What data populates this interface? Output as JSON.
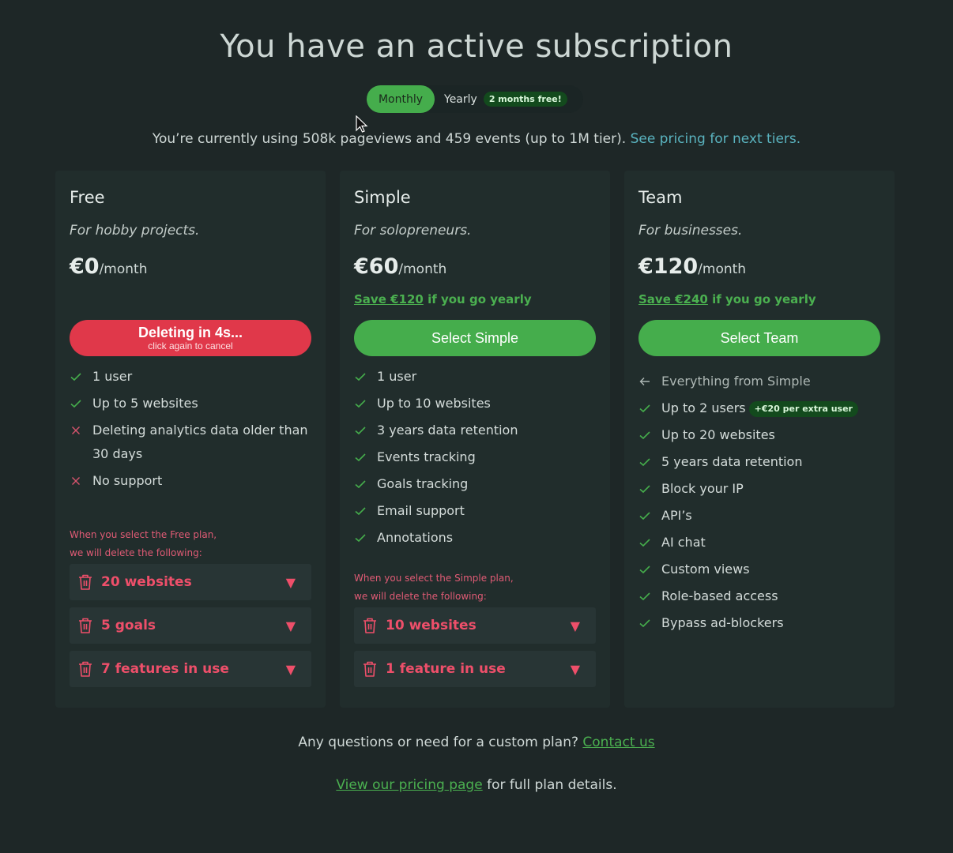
{
  "page": {
    "title": "You have an active subscription"
  },
  "billing_toggle": {
    "monthly_label": "Monthly",
    "yearly_label": "Yearly",
    "yearly_badge": "2 months free!",
    "selected": "Monthly"
  },
  "usage": {
    "text": "You’re currently using 508k pageviews and 459 events (up to 1M tier).",
    "link": "See pricing for next tiers."
  },
  "plans": {
    "free": {
      "name": "Free",
      "tagline": "For hobby projects.",
      "price": "€0",
      "period": "/month",
      "button_line1": "Deleting in 4s...",
      "button_line2": "click again to cancel",
      "features": [
        {
          "text": "1 user",
          "status": "included"
        },
        {
          "text": "Up to 5 websites",
          "status": "included"
        },
        {
          "text": "Deleting analytics data older than 30 days",
          "status": "excluded"
        },
        {
          "text": "No support",
          "status": "excluded"
        }
      ],
      "warning_line1": "When you select the Free plan,",
      "warning_line2": "we will delete the following:",
      "deletions": [
        "20 websites",
        "5 goals",
        "7 features in use"
      ]
    },
    "simple": {
      "name": "Simple",
      "tagline": "For solopreneurs.",
      "price": "€60",
      "period": "/month",
      "save_amount": "Save €120",
      "save_suffix": " if you go yearly",
      "button_label": "Select Simple",
      "features": [
        {
          "text": "1 user",
          "status": "included"
        },
        {
          "text": "Up to 10 websites",
          "status": "included"
        },
        {
          "text": "3 years data retention",
          "status": "included"
        },
        {
          "text": "Events tracking",
          "status": "included"
        },
        {
          "text": "Goals tracking",
          "status": "included"
        },
        {
          "text": "Email support",
          "status": "included"
        },
        {
          "text": "Annotations",
          "status": "included"
        }
      ],
      "warning_line1": "When you select the Simple plan,",
      "warning_line2": "we will delete the following:",
      "deletions": [
        "10 websites",
        "1 feature in use"
      ]
    },
    "team": {
      "name": "Team",
      "tagline": "For businesses.",
      "price": "€120",
      "period": "/month",
      "save_amount": "Save €240",
      "save_suffix": " if you go yearly",
      "button_label": "Select Team",
      "everything_from": "Everything from Simple",
      "extra_user_badge": "+€20 per extra user",
      "features": [
        {
          "text": "Up to 2 users",
          "status": "included"
        },
        {
          "text": "Up to 20 websites",
          "status": "included"
        },
        {
          "text": "5 years data retention",
          "status": "included"
        },
        {
          "text": "Block your IP",
          "status": "included"
        },
        {
          "text": "API’s",
          "status": "included"
        },
        {
          "text": "AI chat",
          "status": "included"
        },
        {
          "text": "Custom views",
          "status": "included"
        },
        {
          "text": "Role-based access",
          "status": "included"
        },
        {
          "text": "Bypass ad-blockers",
          "status": "included"
        }
      ]
    }
  },
  "footer": {
    "question": "Any questions or need for a custom plan?",
    "contact_link": "Contact us",
    "pricing_link": "View our pricing page",
    "pricing_suffix": " for full plan details."
  },
  "colors": {
    "background": "#1e2727",
    "card": "#212d2c",
    "accent_green": "#45ad4c",
    "danger_red": "#e0384a",
    "link_blue": "#5ab3bf"
  },
  "icons": {
    "included": "check-icon",
    "excluded": "x-icon",
    "deletion": "trash-icon",
    "expand": "caret-down-icon",
    "back": "arrow-left-icon"
  }
}
